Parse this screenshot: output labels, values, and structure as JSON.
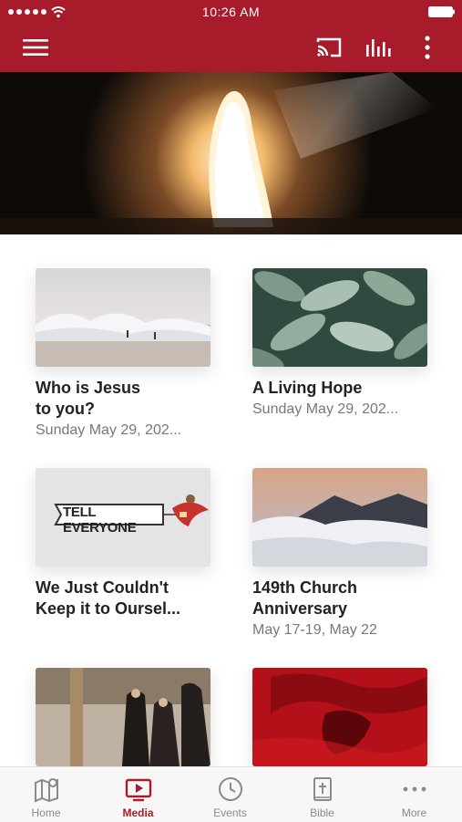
{
  "status": {
    "time": "10:26 AM"
  },
  "appbar": {
    "menu_icon": "hamburger-menu-icon",
    "cast_icon": "cast-icon",
    "audio_icon": "audio-bars-icon",
    "more_icon": "vertical-dots-icon"
  },
  "hero": {
    "image": "empty-tomb-light"
  },
  "media": [
    {
      "title": "Who is Jesus\nto you?",
      "subtitle": "Sunday May 29, 202...",
      "image": "beach-waves"
    },
    {
      "title": "A Living Hope",
      "subtitle": "Sunday May 29, 202...",
      "image": "green-leaves"
    },
    {
      "title": "We Just Couldn't\nKeep it to Oursel...",
      "subtitle": "",
      "image": "tell-everyone-banner",
      "banner_text": "TELL EVERYONE"
    },
    {
      "title": "149th Church\nAnniversary",
      "subtitle": "May 17-19, May 22",
      "image": "mountain-clouds"
    },
    {
      "title": "",
      "subtitle": "",
      "image": "crowd-scene"
    },
    {
      "title": "",
      "subtitle": "",
      "image": "red-crown-of-thorns"
    }
  ],
  "tabs": [
    {
      "label": "Home",
      "icon": "map-pin-icon",
      "active": false
    },
    {
      "label": "Media",
      "icon": "tv-play-icon",
      "active": true
    },
    {
      "label": "Events",
      "icon": "clock-icon",
      "active": false
    },
    {
      "label": "Bible",
      "icon": "bible-cross-icon",
      "active": false
    },
    {
      "label": "More",
      "icon": "horizontal-dots-icon",
      "active": false
    }
  ],
  "colors": {
    "brand": "#a81b2b",
    "tab_inactive": "#8a8a8a"
  }
}
